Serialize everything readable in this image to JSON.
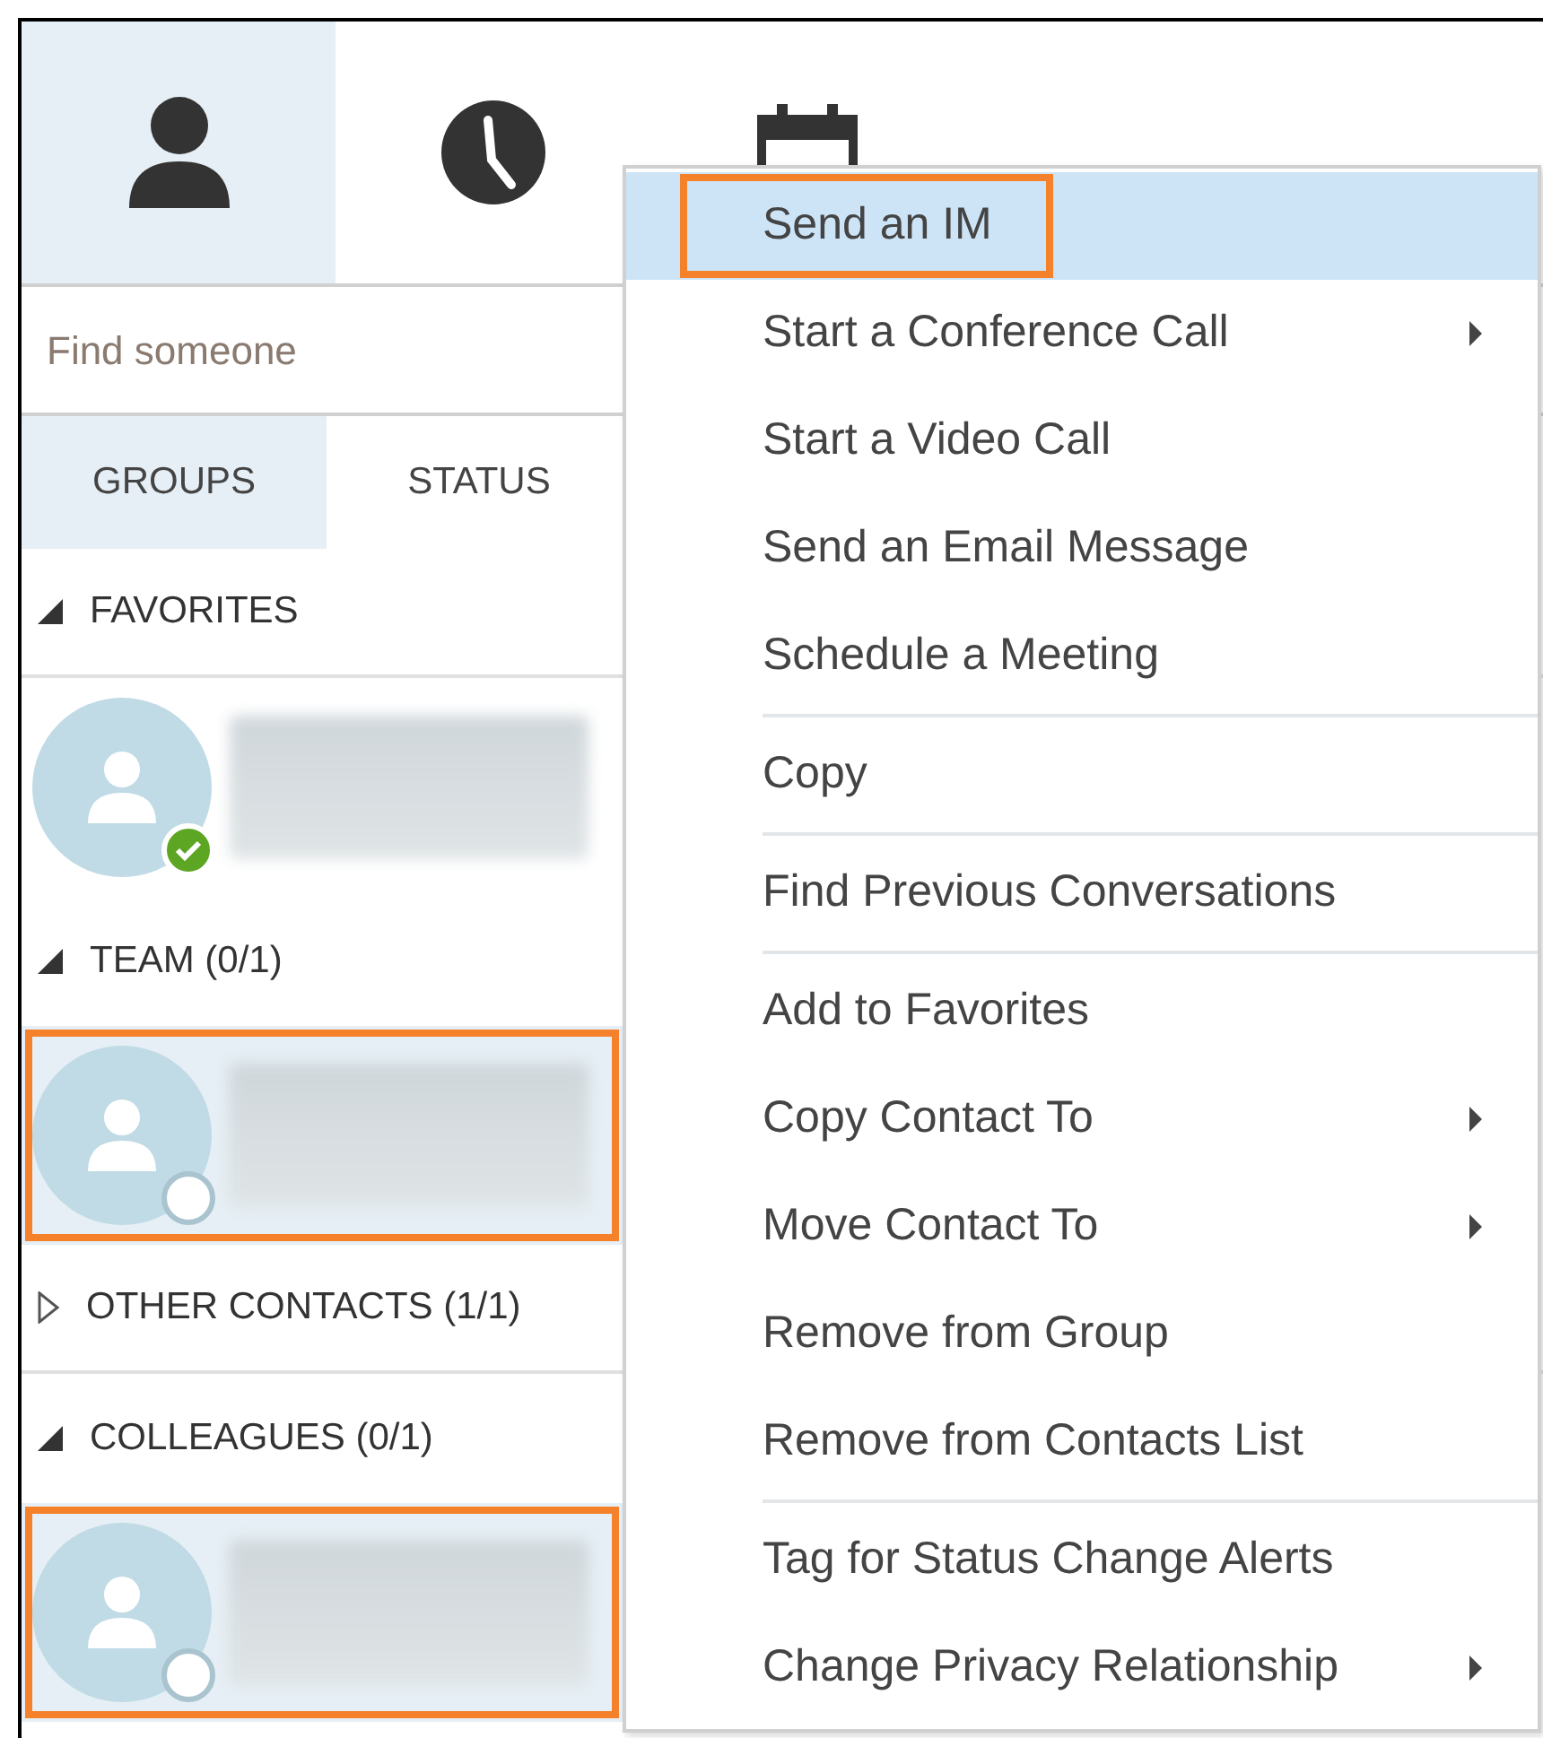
{
  "top_tabs": [
    {
      "selected": true
    },
    {
      "selected": false
    },
    {
      "selected": false
    }
  ],
  "search": {
    "placeholder": "Find someone"
  },
  "view_tabs": [
    {
      "label": "GROUPS",
      "selected": true
    },
    {
      "label": "STATUS",
      "selected": false
    }
  ],
  "groups": [
    {
      "label": "FAVORITES",
      "expanded": true,
      "contacts": [
        {
          "available": true,
          "selected": false,
          "annotated": false
        }
      ]
    },
    {
      "label": "TEAM (0/1)",
      "expanded": true,
      "contacts": [
        {
          "available": false,
          "selected": true,
          "annotated": true
        }
      ]
    },
    {
      "label": "OTHER CONTACTS (1/1)",
      "expanded": false
    },
    {
      "label": "COLLEAGUES (0/1)",
      "expanded": true,
      "contacts": [
        {
          "available": false,
          "selected": true,
          "annotated": true
        }
      ]
    }
  ],
  "context_menu": {
    "items": [
      {
        "kind": "item",
        "label": "Send an IM",
        "submenu": false,
        "selected": true,
        "annotated": true
      },
      {
        "kind": "item",
        "label": "Start a Conference Call",
        "submenu": true,
        "selected": false,
        "annotated": false
      },
      {
        "kind": "item",
        "label": "Start a Video Call",
        "submenu": false,
        "selected": false,
        "annotated": false
      },
      {
        "kind": "item",
        "label": "Send an Email Message",
        "submenu": false,
        "selected": false,
        "annotated": false
      },
      {
        "kind": "item",
        "label": "Schedule a Meeting",
        "submenu": false,
        "selected": false,
        "annotated": false
      },
      {
        "kind": "separator"
      },
      {
        "kind": "item",
        "label": "Copy",
        "submenu": false,
        "selected": false,
        "annotated": false
      },
      {
        "kind": "separator"
      },
      {
        "kind": "item",
        "label": "Find Previous Conversations",
        "submenu": false,
        "selected": false,
        "annotated": false
      },
      {
        "kind": "separator"
      },
      {
        "kind": "item",
        "label": "Add to Favorites",
        "submenu": false,
        "selected": false,
        "annotated": false
      },
      {
        "kind": "item",
        "label": "Copy Contact To",
        "submenu": true,
        "selected": false,
        "annotated": false
      },
      {
        "kind": "item",
        "label": "Move Contact To",
        "submenu": true,
        "selected": false,
        "annotated": false
      },
      {
        "kind": "item",
        "label": "Remove from Group",
        "submenu": false,
        "selected": false,
        "annotated": false
      },
      {
        "kind": "item",
        "label": "Remove from Contacts List",
        "submenu": false,
        "selected": false,
        "annotated": false
      },
      {
        "kind": "separator"
      },
      {
        "kind": "item",
        "label": "Tag for Status Change Alerts",
        "submenu": false,
        "selected": false,
        "annotated": false
      },
      {
        "kind": "item",
        "label": "Change Privacy Relationship",
        "submenu": true,
        "selected": false,
        "annotated": false
      }
    ]
  }
}
